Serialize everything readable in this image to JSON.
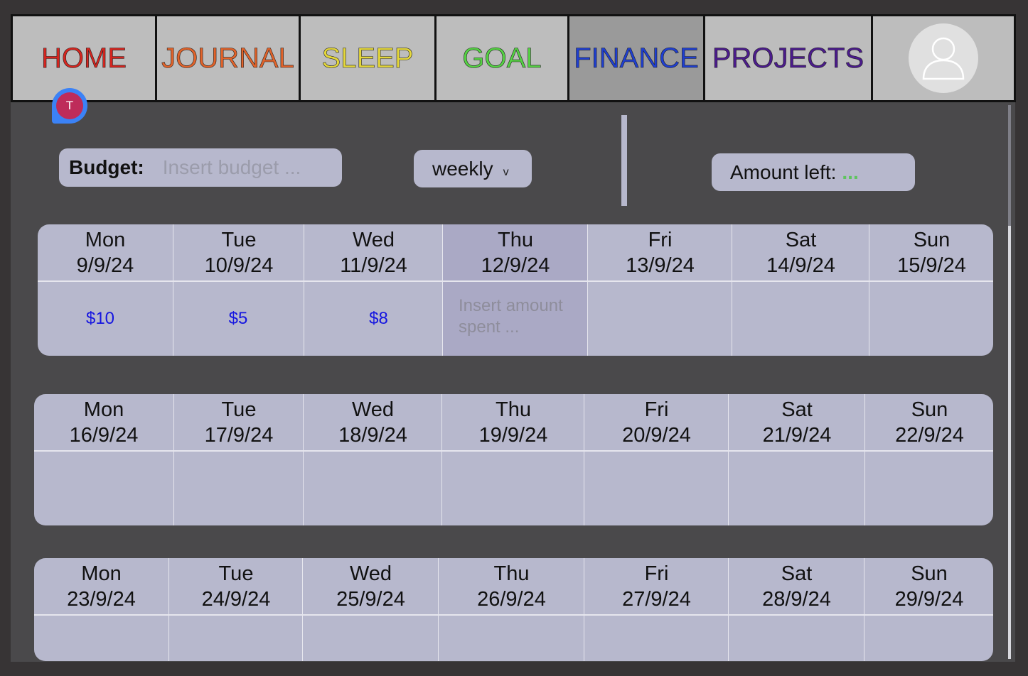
{
  "nav": {
    "tabs": [
      {
        "label": "HOME",
        "color": "#d6251f"
      },
      {
        "label": "JOURNAL",
        "color": "#e2632a"
      },
      {
        "label": "SLEEP",
        "color": "#e5d83a"
      },
      {
        "label": "GOAL",
        "color": "#55d243"
      },
      {
        "label": "FINANCE",
        "color": "#1f3fd1"
      },
      {
        "label": "PROJECTS",
        "color": "#4b1b8c"
      }
    ],
    "active": "FINANCE",
    "profile_icon": "user-avatar-icon"
  },
  "notification": {
    "initial": "T",
    "icon": "chat-bubble-icon"
  },
  "budget": {
    "label": "Budget:",
    "placeholder": "Insert budget ...",
    "value": ""
  },
  "period": {
    "value": "weekly",
    "icon": "chevron-down-icon"
  },
  "amount_left": {
    "label": "Amount left:",
    "value": "..."
  },
  "weeks": [
    {
      "days": [
        {
          "day": "Mon",
          "date": "9/9/24",
          "amount": "$10"
        },
        {
          "day": "Tue",
          "date": "10/9/24",
          "amount": "$5"
        },
        {
          "day": "Wed",
          "date": "11/9/24",
          "amount": "$8"
        },
        {
          "day": "Thu",
          "date": "12/9/24",
          "amount": "",
          "placeholder": "Insert amount spent ...",
          "today": true
        },
        {
          "day": "Fri",
          "date": "13/9/24",
          "amount": ""
        },
        {
          "day": "Sat",
          "date": "14/9/24",
          "amount": ""
        },
        {
          "day": "Sun",
          "date": "15/9/24",
          "amount": ""
        }
      ]
    },
    {
      "days": [
        {
          "day": "Mon",
          "date": "16/9/24",
          "amount": ""
        },
        {
          "day": "Tue",
          "date": "17/9/24",
          "amount": ""
        },
        {
          "day": "Wed",
          "date": "18/9/24",
          "amount": ""
        },
        {
          "day": "Thu",
          "date": "19/9/24",
          "amount": ""
        },
        {
          "day": "Fri",
          "date": "20/9/24",
          "amount": ""
        },
        {
          "day": "Sat",
          "date": "21/9/24",
          "amount": ""
        },
        {
          "day": "Sun",
          "date": "22/9/24",
          "amount": ""
        }
      ]
    },
    {
      "days": [
        {
          "day": "Mon",
          "date": "23/9/24",
          "amount": ""
        },
        {
          "day": "Tue",
          "date": "24/9/24",
          "amount": ""
        },
        {
          "day": "Wed",
          "date": "25/9/24",
          "amount": ""
        },
        {
          "day": "Thu",
          "date": "26/9/24",
          "amount": ""
        },
        {
          "day": "Fri",
          "date": "27/9/24",
          "amount": ""
        },
        {
          "day": "Sat",
          "date": "28/9/24",
          "amount": ""
        },
        {
          "day": "Sun",
          "date": "29/9/24",
          "amount": ""
        }
      ]
    }
  ]
}
